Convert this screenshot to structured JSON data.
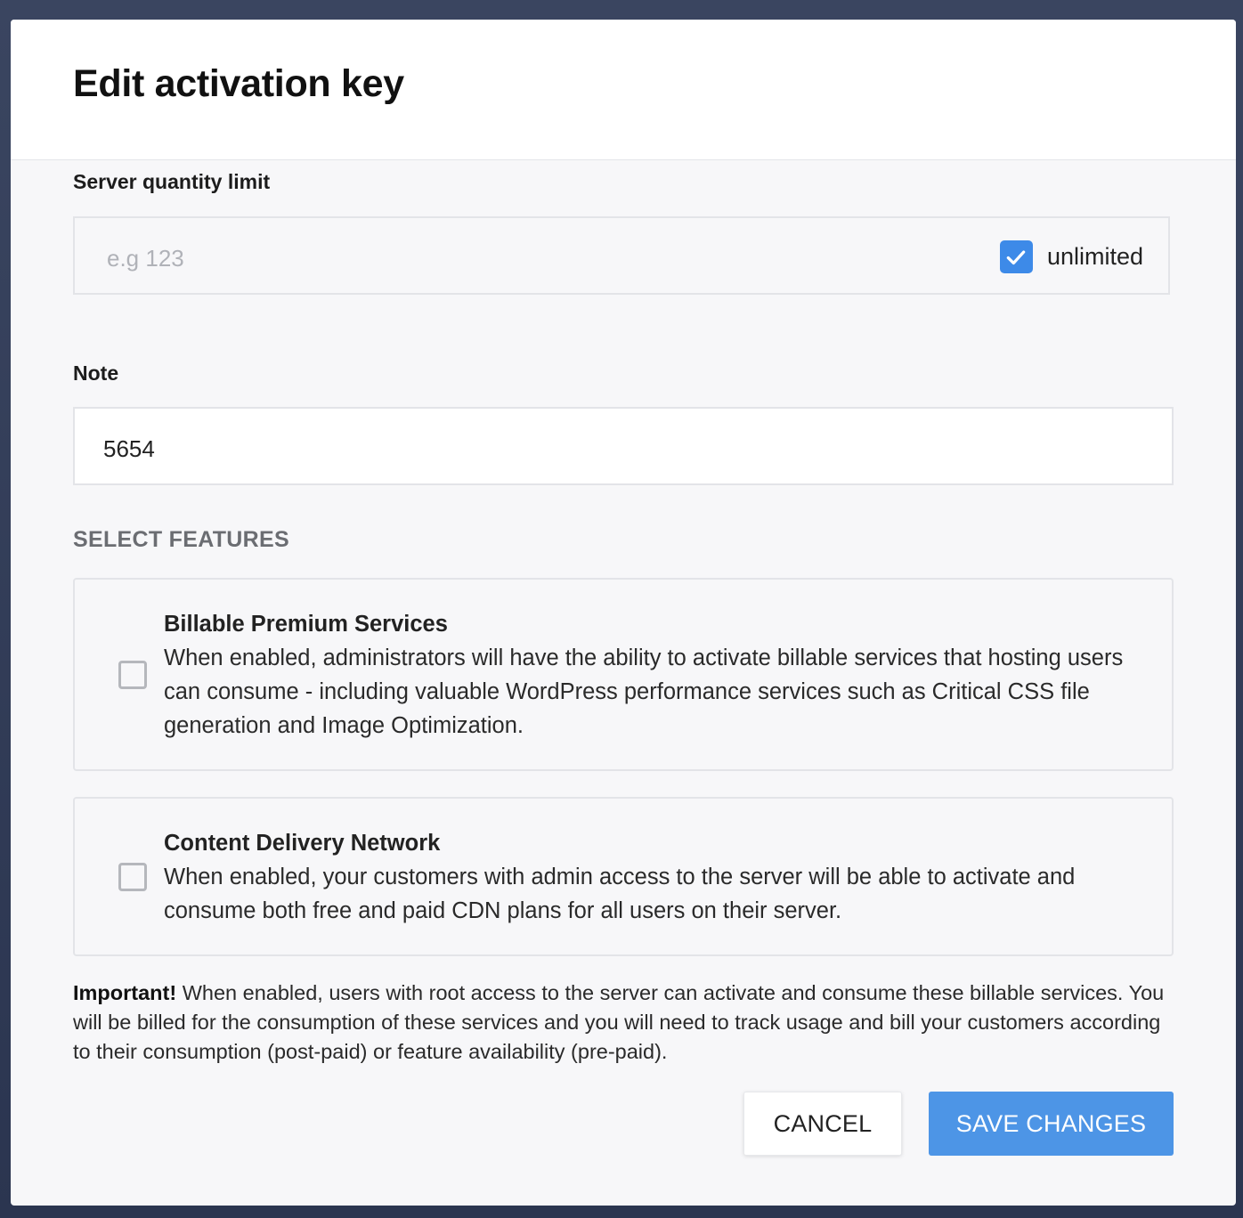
{
  "modal": {
    "title": "Edit activation key"
  },
  "server_quantity": {
    "label": "Server quantity limit",
    "placeholder": "e.g 123",
    "value": "",
    "unlimited_label": "unlimited",
    "unlimited_checked": true
  },
  "note": {
    "label": "Note",
    "value": "5654"
  },
  "features": {
    "section_title": "SELECT FEATURES",
    "items": [
      {
        "title": "Billable Premium Services",
        "description": "When enabled, administrators will have the ability to activate billable services that hosting users can consume - including valuable WordPress performance services such as Critical CSS file generation and Image Optimization.",
        "checked": false
      },
      {
        "title": "Content Delivery Network",
        "description": "When enabled, your customers with admin access to the server will be able to activate and consume both free and paid CDN plans for all users on their server.",
        "checked": false
      }
    ]
  },
  "notice": {
    "strong": "Important!",
    "text": " When enabled, users with root access to the server can activate and consume these billable services. You will be billed for the consumption of these services and you will need to track usage and bill your customers according to their consumption (post-paid) or feature availability (pre-paid)."
  },
  "actions": {
    "cancel_label": "CANCEL",
    "save_label": "SAVE CHANGES"
  },
  "colors": {
    "primary": "#4d95e6",
    "checkbox_checked": "#3d8ae8",
    "modal_bg": "#f7f7f9",
    "backdrop": "#2b3550"
  },
  "icons": {
    "unlimited_checkbox": "check-icon"
  }
}
